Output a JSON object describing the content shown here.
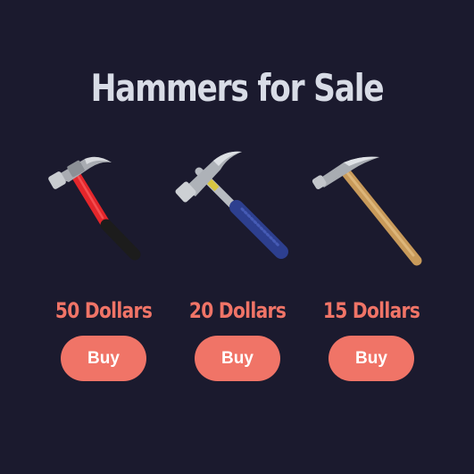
{
  "page": {
    "title": "Hammers for Sale"
  },
  "products": [
    {
      "price": "50 Dollars",
      "buy_label": "Buy",
      "image": "red-fiberglass-claw-hammer"
    },
    {
      "price": "20 Dollars",
      "buy_label": "Buy",
      "image": "blue-grip-steel-claw-hammer"
    },
    {
      "price": "15 Dollars",
      "buy_label": "Buy",
      "image": "wooden-handle-claw-hammer"
    }
  ],
  "colors": {
    "background": "#1b1a2e",
    "title": "#d8dce6",
    "accent": "#f07467",
    "button_text": "#ffffff"
  }
}
